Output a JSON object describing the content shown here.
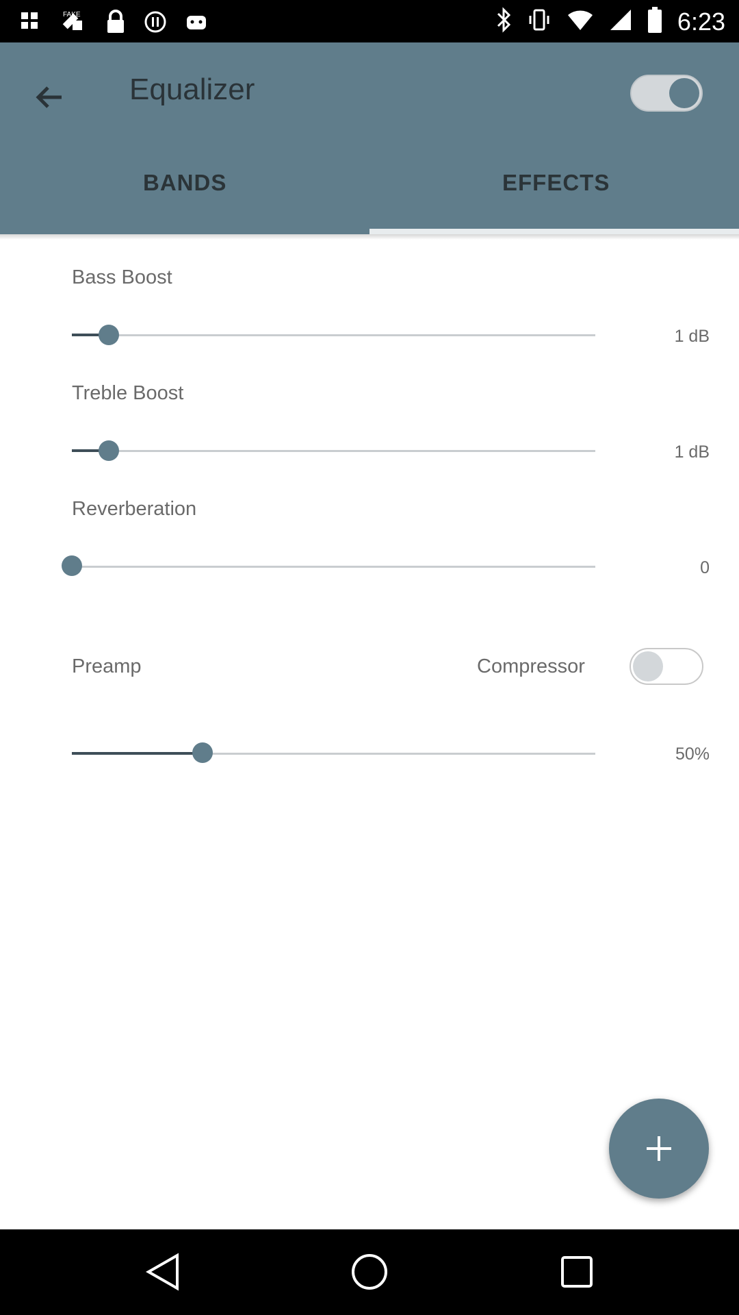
{
  "status_bar": {
    "time": "6:23",
    "left_icons": [
      "photos-icon",
      "fake-gps-icon",
      "lock-icon",
      "pause-icon",
      "android-icon"
    ],
    "right_icons": [
      "bluetooth-icon",
      "vibrate-icon",
      "wifi-icon",
      "signal-icon",
      "battery-icon"
    ]
  },
  "app_bar": {
    "title": "Equalizer",
    "equalizer_enabled": true,
    "tabs": [
      {
        "label": "BANDS",
        "selected": false
      },
      {
        "label": "EFFECTS",
        "selected": true
      }
    ]
  },
  "effects": {
    "bass_boost": {
      "label": "Bass Boost",
      "value_label": "1 dB",
      "level": 0.07
    },
    "treble_boost": {
      "label": "Treble Boost",
      "value_label": "1 dB",
      "level": 0.07
    },
    "reverberation": {
      "label": "Reverberation",
      "value_label": "0",
      "level": 0
    },
    "preamp": {
      "label": "Preamp",
      "value_label": "50%",
      "level": 0.25
    },
    "compressor": {
      "label": "Compressor",
      "enabled": false
    }
  },
  "fab": {
    "icon": "plus-icon"
  },
  "nav_bar": {
    "buttons": [
      "back-icon",
      "home-icon",
      "recents-icon"
    ]
  },
  "colors": {
    "primary": "#607d8b",
    "status_bar": "#000000",
    "tab_text": "#2b3438",
    "slider_fill": "#3e4e58"
  }
}
